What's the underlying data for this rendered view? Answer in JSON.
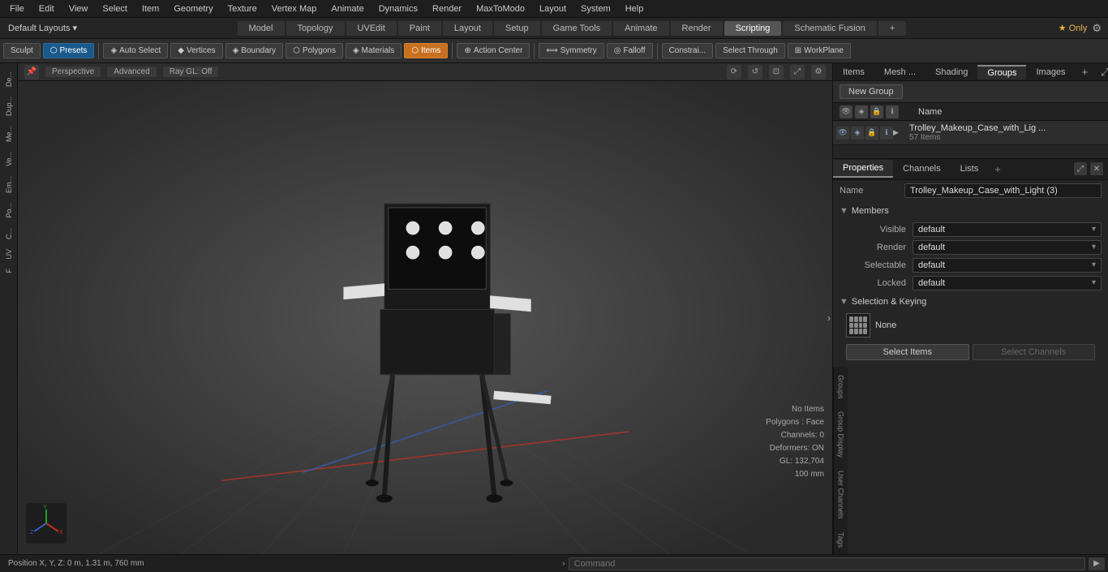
{
  "menu": {
    "items": [
      "File",
      "Edit",
      "View",
      "Select",
      "Item",
      "Geometry",
      "Texture",
      "Vertex Map",
      "Animate",
      "Dynamics",
      "Render",
      "MaxToModo",
      "Layout",
      "System",
      "Help"
    ]
  },
  "layout_bar": {
    "selector": "Default Layouts ▾",
    "tabs": [
      "Model",
      "Topology",
      "UVEdit",
      "Paint",
      "Layout",
      "Setup",
      "Game Tools",
      "Animate",
      "Render",
      "Scripting",
      "Schematic Fusion"
    ],
    "active_tab": "Scripting",
    "star_label": "★ Only",
    "settings_label": "⚙"
  },
  "toolbar": {
    "sculpt": "Sculpt",
    "presets": "Presets",
    "auto_select": "Auto Select",
    "vertices": "Vertices",
    "boundary": "Boundary",
    "polygons": "Polygons",
    "materials": "Materials",
    "items": "Items",
    "action_center": "Action Center",
    "symmetry": "Symmetry",
    "falloff": "Falloff",
    "constraints": "Constrai...",
    "select_through": "Select Through",
    "workplane": "WorkPlane"
  },
  "viewport": {
    "mode": "Perspective",
    "shading": "Advanced",
    "ray_gl": "Ray GL: Off",
    "info": {
      "no_items": "No Items",
      "polygons": "Polygons : Face",
      "channels": "Channels: 0",
      "deformers": "Deformers: ON",
      "gl": "GL: 132,704",
      "size": "100 mm"
    }
  },
  "left_sidebar": {
    "tabs": [
      "De...",
      "Dup...",
      "Me...",
      "Ve...",
      "Em...",
      "Po...",
      "C...",
      "UV",
      "F"
    ]
  },
  "right_panel": {
    "tabs": [
      "Items",
      "Mesh ...",
      "Shading",
      "Groups",
      "Images"
    ],
    "active_tab": "Groups",
    "new_group_btn": "New Group",
    "list_header": "Name",
    "group_item": {
      "name": "Trolley_Makeup_Case_with_Lig ...",
      "count": "57 Items"
    }
  },
  "properties": {
    "tabs": [
      "Properties",
      "Channels",
      "Lists"
    ],
    "active_tab": "Properties",
    "name_label": "Name",
    "name_value": "Trolley_Makeup_Case_with_Light (3)",
    "sections": {
      "members": "Members",
      "selection_keying": "Selection & Keying"
    },
    "members": {
      "visible_label": "Visible",
      "visible_value": "default",
      "render_label": "Render",
      "render_value": "default",
      "selectable_label": "Selectable",
      "selectable_value": "default",
      "locked_label": "Locked",
      "locked_value": "default"
    },
    "selection_keying": {
      "none_label": "None",
      "select_items_btn": "Select Items",
      "select_channels_btn": "Select Channels"
    }
  },
  "right_vtabs": [
    "Groups",
    "Group Display",
    "User Channels",
    "Tags"
  ],
  "bottom_bar": {
    "position": "Position X, Y, Z:  0 m, 1.31 m, 760 mm",
    "command_label": "Command",
    "command_placeholder": "Command"
  }
}
